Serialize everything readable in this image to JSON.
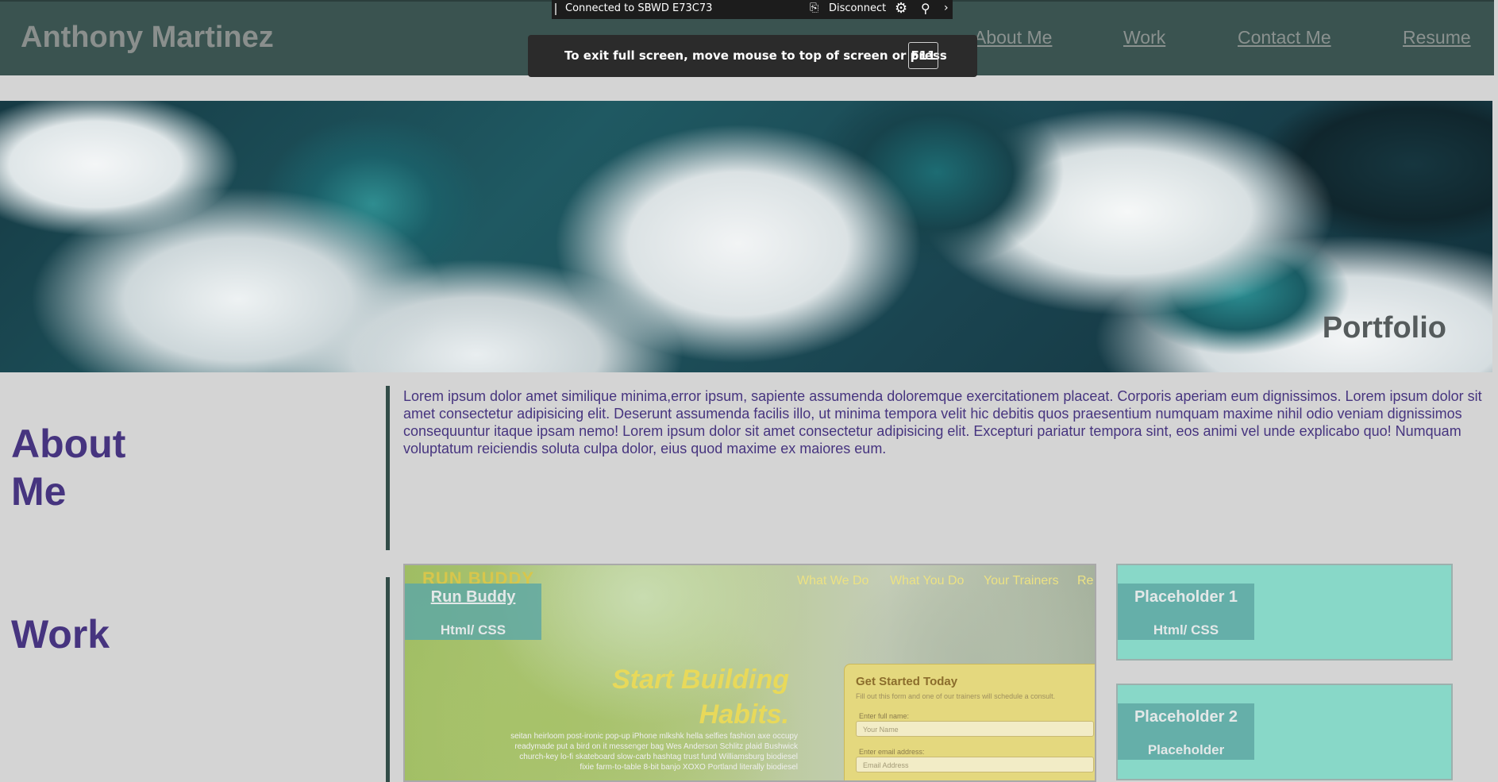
{
  "header": {
    "title": "Anthony Martinez",
    "nav": [
      "About Me",
      "Work",
      "Contact Me",
      "Resume"
    ]
  },
  "rdp": {
    "connection": "Connected to SBWD E73C73",
    "disconnect": "Disconnect"
  },
  "toast": {
    "message": "To exit full screen, move mouse to top of screen or press",
    "key": "F11"
  },
  "hero": {
    "title": "Portfolio"
  },
  "about": {
    "title": "About Me",
    "text": "Lorem ipsum dolor amet similique minima,error ipsum, sapiente assumenda doloremque exercitationem placeat. Corporis aperiam eum dignissimos. Lorem ipsum dolor sit amet consectetur adipisicing elit. Deserunt assumenda facilis illo, ut minima tempora velit hic debitis quos praesentium numquam maxime nihil odio veniam dignissimos consequuntur itaque ipsam nemo! Lorem ipsum dolor sit amet consectetur adipisicing elit. Excepturi pariatur tempora sint, eos animi vel unde explicabo quo! Numquam voluptatum reiciendis soluta culpa dolor, eius quod maxime ex maiores eum."
  },
  "work": {
    "title": "Work",
    "projects": [
      {
        "title": "Run Buddy",
        "subtitle": "Html/ CSS"
      },
      {
        "title": "Placeholder 1",
        "subtitle": "Html/ CSS"
      },
      {
        "title": "Placeholder 2",
        "subtitle": "Placeholder"
      }
    ],
    "preview": {
      "logo": "RUN BUDDY",
      "nav": [
        "What We Do",
        "What You Do",
        "Your Trainers",
        "Re"
      ],
      "headline_1": "Start Building",
      "headline_2": "Habits.",
      "body": "seitan heirloom post-ironic pop-up iPhone mlkshk hella selfies fashion axe occupy readymade put a bird on it messenger bag Wes Anderson Schlitz plaid Bushwick church-key lo-fi skateboard slow-carb hashtag trust fund Williamsburg biodiesel fixie farm-to-table 8-bit banjo XOXO Portland literally biodiesel",
      "form_title": "Get Started Today",
      "form_sub": "Fill out this form and one of our trainers will schedule a consult.",
      "name_label": "Enter full name:",
      "name_placeholder": "Your Name",
      "email_label": "Enter email address:",
      "email_placeholder": "Email Address"
    }
  }
}
